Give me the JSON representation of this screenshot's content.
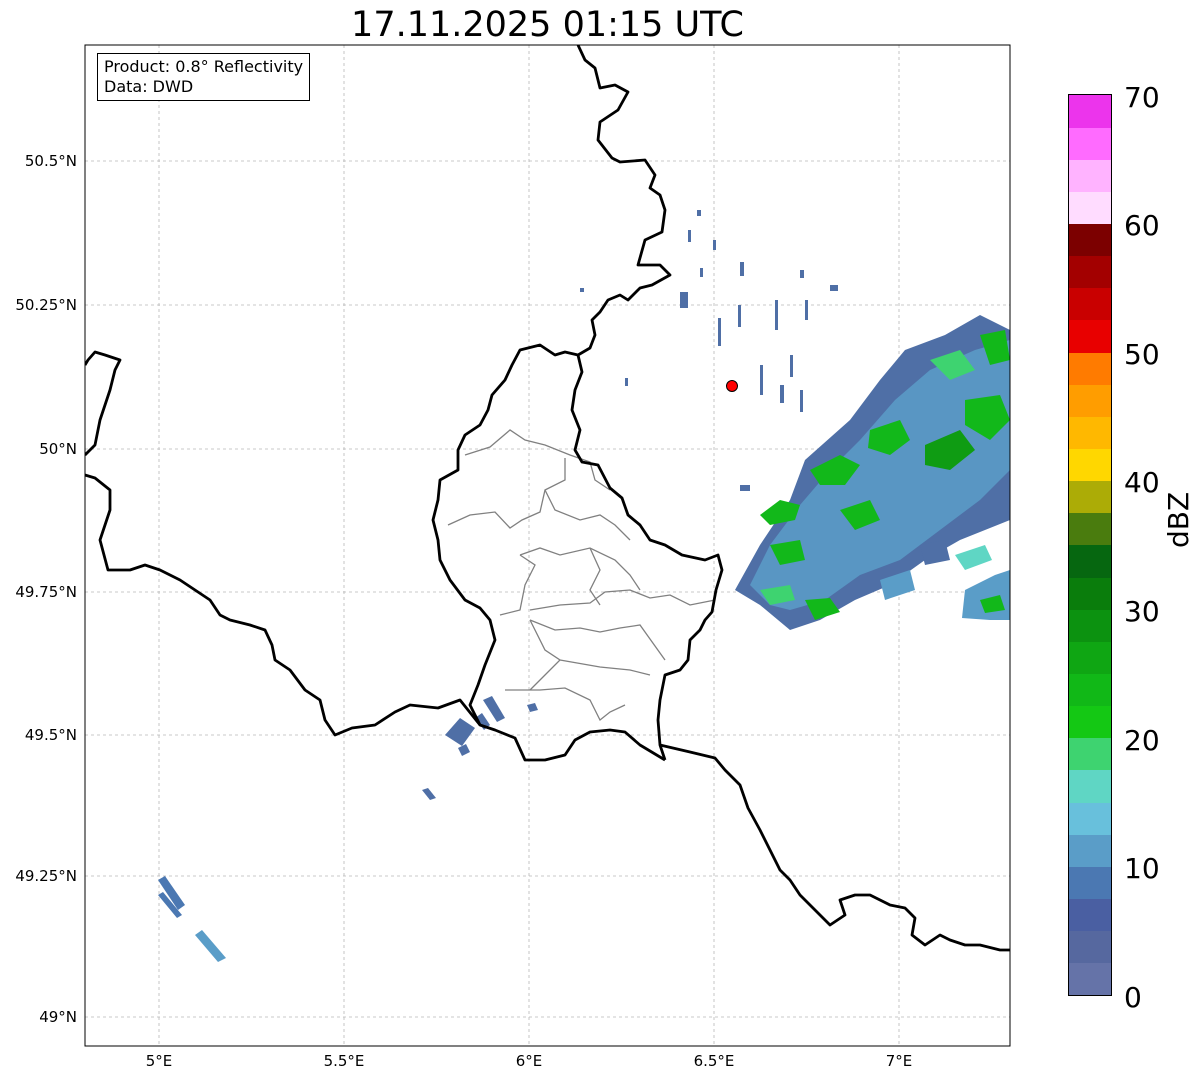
{
  "title": "17.11.2025 01:15 UTC",
  "info": {
    "product": "Product: 0.8° Reflectivity",
    "data": "Data: DWD"
  },
  "map": {
    "lon_range": [
      4.8,
      7.3
    ],
    "lat_range": [
      48.95,
      50.7
    ],
    "lat_ticks": [
      "50.5°N",
      "50.25°N",
      "50°N",
      "49.75°N",
      "49.5°N",
      "49.25°N",
      "49°N"
    ],
    "lon_ticks": [
      "5°E",
      "5.5°E",
      "6°E",
      "6.5°E",
      "7°E"
    ],
    "radar_site": {
      "lon": 6.55,
      "lat": 50.11,
      "color": "#ff0000"
    },
    "border_color": "#000000",
    "admin_color": "#808080"
  },
  "colorbar": {
    "label": "dBZ",
    "ticks": [
      "0",
      "10",
      "20",
      "30",
      "40",
      "50",
      "60",
      "70"
    ],
    "colors": [
      "#6573a8",
      "#56689f",
      "#4a5fa2",
      "#4b78b2",
      "#5a9dc8",
      "#68c0dc",
      "#5fd6c4",
      "#3ed370",
      "#14c814",
      "#11b817",
      "#0fa613",
      "#0c9210",
      "#0a7d0c",
      "#066710",
      "#4a7c0e",
      "#acac06",
      "#ffd700",
      "#ffb800",
      "#ff9d00",
      "#ff7b00",
      "#e80000",
      "#c90000",
      "#a30000",
      "#7c0000",
      "#ffdcff",
      "#ffb3ff",
      "#ff6bff",
      "#ec34ec"
    ]
  }
}
